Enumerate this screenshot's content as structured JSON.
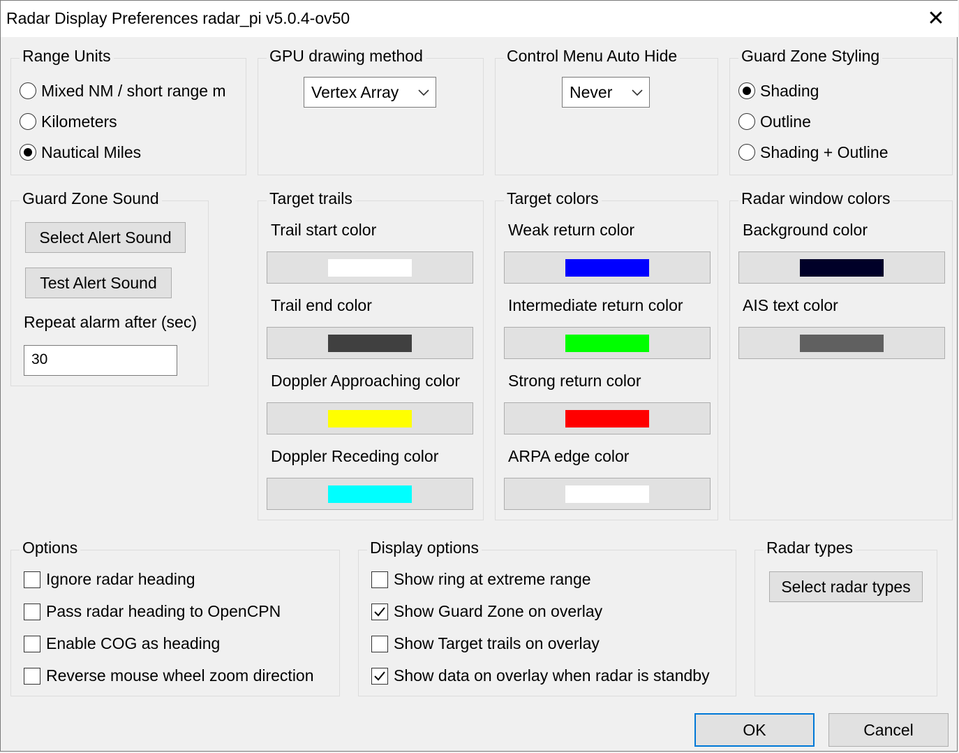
{
  "window": {
    "title": "Radar Display Preferences radar_pi v5.0.4-ov50"
  },
  "range_units": {
    "label": "Range Units",
    "options": [
      "Mixed NM / short range m",
      "Kilometers",
      "Nautical Miles"
    ],
    "selected": "Nautical Miles"
  },
  "gpu": {
    "label": "GPU drawing method",
    "value": "Vertex Array"
  },
  "control_menu": {
    "label": "Control Menu Auto Hide",
    "value": "Never"
  },
  "guard_zone_styling": {
    "label": "Guard Zone Styling",
    "options": [
      "Shading",
      "Outline",
      "Shading + Outline"
    ],
    "selected": "Shading"
  },
  "guard_zone_sound": {
    "label": "Guard Zone Sound",
    "select_button": "Select Alert Sound",
    "test_button": "Test Alert Sound",
    "repeat_label": "Repeat alarm after (sec)",
    "repeat_value": "30"
  },
  "target_trails": {
    "label": "Target trails",
    "items": [
      {
        "label": "Trail start color",
        "color": "#ffffff"
      },
      {
        "label": "Trail end color",
        "color": "#404040"
      },
      {
        "label": "Doppler Approaching color",
        "color": "#ffff00"
      },
      {
        "label": "Doppler Receding color",
        "color": "#00ffff"
      }
    ]
  },
  "target_colors": {
    "label": "Target colors",
    "items": [
      {
        "label": "Weak return color",
        "color": "#0000ff"
      },
      {
        "label": "Intermediate return color",
        "color": "#00ff00"
      },
      {
        "label": "Strong return color",
        "color": "#ff0000"
      },
      {
        "label": "ARPA edge color",
        "color": "#ffffff"
      }
    ]
  },
  "radar_window_colors": {
    "label": "Radar window colors",
    "items": [
      {
        "label": "Background color",
        "color": "#000028"
      },
      {
        "label": "AIS text color",
        "color": "#606060"
      }
    ]
  },
  "options": {
    "label": "Options",
    "items": [
      {
        "label": "Ignore radar heading",
        "checked": false
      },
      {
        "label": "Pass radar heading to OpenCPN",
        "checked": false
      },
      {
        "label": "Enable COG as heading",
        "checked": false
      },
      {
        "label": "Reverse mouse wheel zoom direction",
        "checked": false
      }
    ]
  },
  "display_options": {
    "label": "Display options",
    "items": [
      {
        "label": "Show ring at extreme range",
        "checked": false
      },
      {
        "label": "Show Guard Zone on overlay",
        "checked": true
      },
      {
        "label": "Show Target trails on overlay",
        "checked": false
      },
      {
        "label": "Show data on overlay when radar is standby",
        "checked": true
      }
    ]
  },
  "radar_types": {
    "label": "Radar types",
    "button": "Select radar types"
  },
  "footer": {
    "ok": "OK",
    "cancel": "Cancel"
  }
}
